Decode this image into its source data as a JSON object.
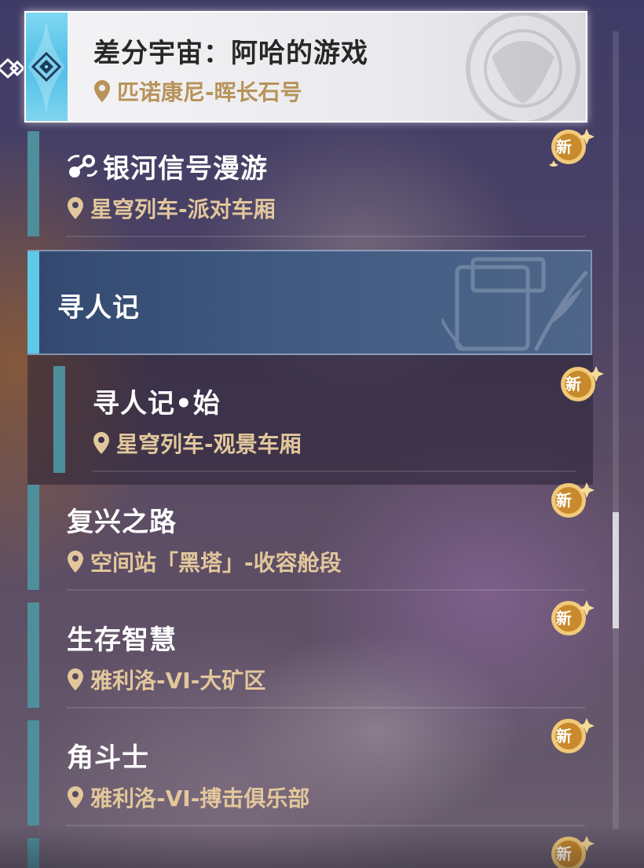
{
  "selected": {
    "title": "差分宇宙：阿哈的游戏",
    "location": "匹诺康尼-晖长石号"
  },
  "items": [
    {
      "title": "银河信号漫游",
      "location": "星穹列车-派对车厢",
      "badge": "新"
    },
    {
      "title": "复兴之路",
      "location": "空间站「黑塔」-收容舱段",
      "badge": "新"
    },
    {
      "title": "生存智慧",
      "location": "雅利洛-VI-大矿区",
      "badge": "新"
    },
    {
      "title": "角斗士",
      "location": "雅利洛-VI-搏击俱乐部",
      "badge": "新"
    }
  ],
  "category": {
    "title": "寻人记",
    "sub": {
      "title": "寻人记•始",
      "location": "星穹列车-观景车厢",
      "badge": "新"
    }
  },
  "partial_badge": "新",
  "colors": {
    "accent": "#5fc9e8",
    "bar": "#4f8e9b",
    "location_text": "#e2c79c",
    "badge": "#e0a640"
  }
}
